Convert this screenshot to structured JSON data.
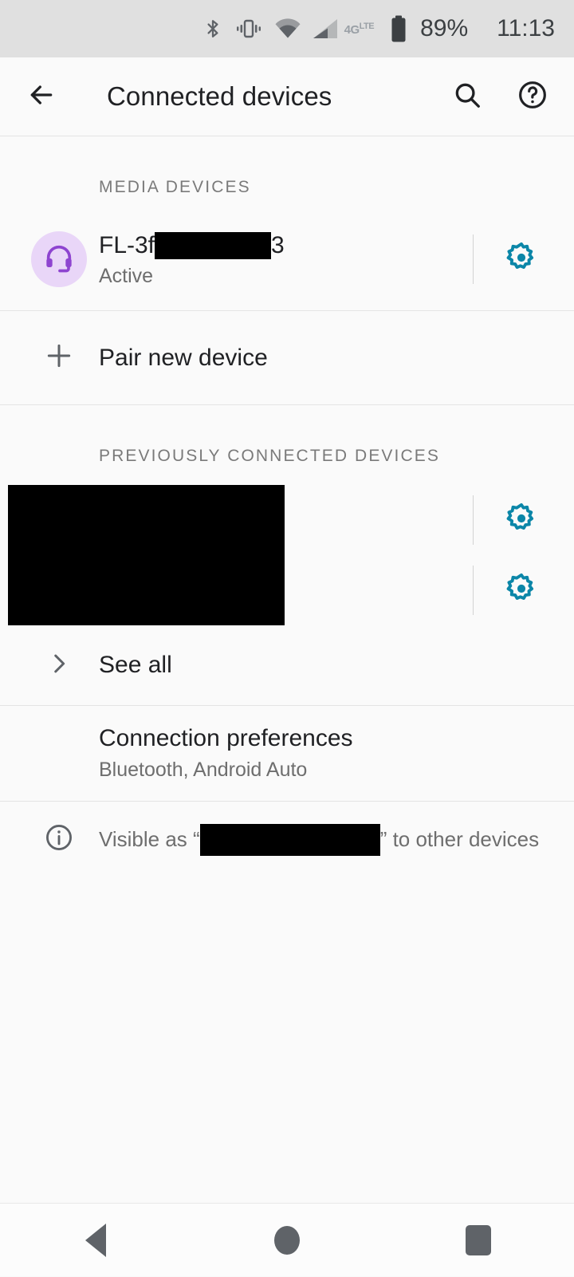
{
  "status_bar": {
    "icons": [
      "bluetooth-icon",
      "vibrate-icon",
      "wifi-icon",
      "cellular-signal-icon"
    ],
    "network_label": "4G",
    "network_sub_label": "LTE",
    "battery_percent": "89%",
    "clock": "11:13"
  },
  "app_bar": {
    "back_label": "back-arrow",
    "title": "Connected devices",
    "search_label": "search-icon",
    "help_label": "help-icon"
  },
  "sections": {
    "media_devices": {
      "header": "MEDIA DEVICES",
      "device": {
        "icon": "headset-icon",
        "name_prefix": "FL-3f",
        "name_redacted": true,
        "name_suffix": "3",
        "status": "Active",
        "settings_label": "settings-gear-icon"
      },
      "pair_new": {
        "icon": "plus-icon",
        "label": "Pair new device"
      }
    },
    "previously_connected": {
      "header": "PREVIOUSLY CONNECTED DEVICES",
      "redacted_block": true,
      "rows": [
        {
          "settings_label": "settings-gear-icon"
        },
        {
          "settings_label": "settings-gear-icon"
        }
      ],
      "see_all": {
        "icon": "chevron-right-icon",
        "label": "See all"
      }
    },
    "connection_preferences": {
      "title": "Connection preferences",
      "subtitle": "Bluetooth, Android Auto"
    },
    "footer": {
      "icon": "info-icon",
      "text_before": "Visible as “",
      "text_after": "” to other devices",
      "name_redacted": true
    }
  },
  "nav_bar": {
    "back": "nav-back-button",
    "home": "nav-home-button",
    "recents": "nav-recents-button"
  },
  "colors": {
    "accent_gear": "#0b86a8",
    "avatar_bg": "#e9d6f8",
    "avatar_fg": "#8e44d0",
    "status_bar_bg": "#e0e0e0",
    "page_bg": "#fafafa",
    "text_primary": "#202124",
    "text_secondary": "#6e6e6e"
  }
}
